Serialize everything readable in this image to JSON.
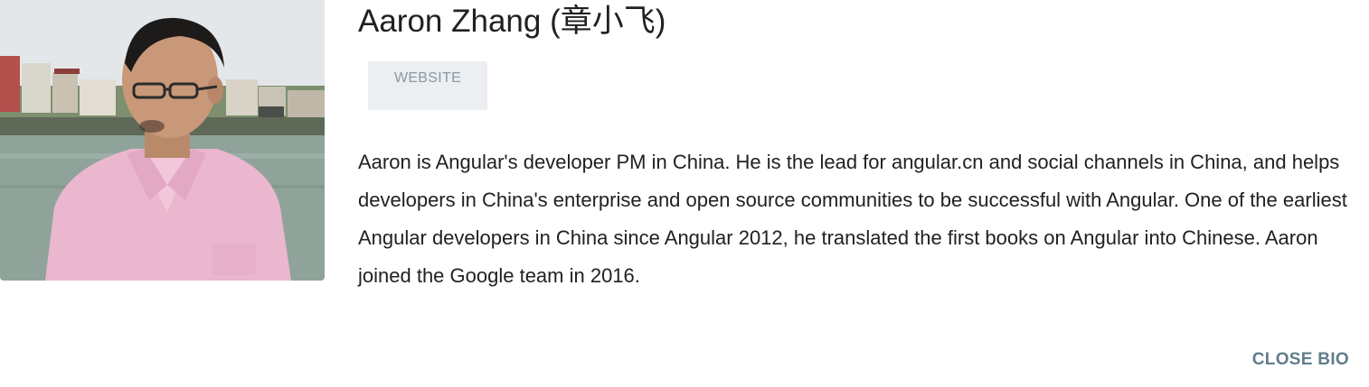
{
  "profile": {
    "name": "Aaron Zhang (章小飞)",
    "website_label": "WEBSITE",
    "bio": "Aaron is Angular's developer PM in China. He is the lead for angular.cn and social channels in China, and helps developers in China's enterprise and open source communities to be successful with Angular. One of the earliest Angular developers in China since Angular 2012, he translated the first books on Angular into Chinese. Aaron joined the Google team in 2016.",
    "close_label": "CLOSE BIO"
  },
  "colors": {
    "website_button_bg": "#eceff1",
    "website_button_text": "#8a98a4",
    "close_text": "#607d8b",
    "body_text": "#212121"
  }
}
